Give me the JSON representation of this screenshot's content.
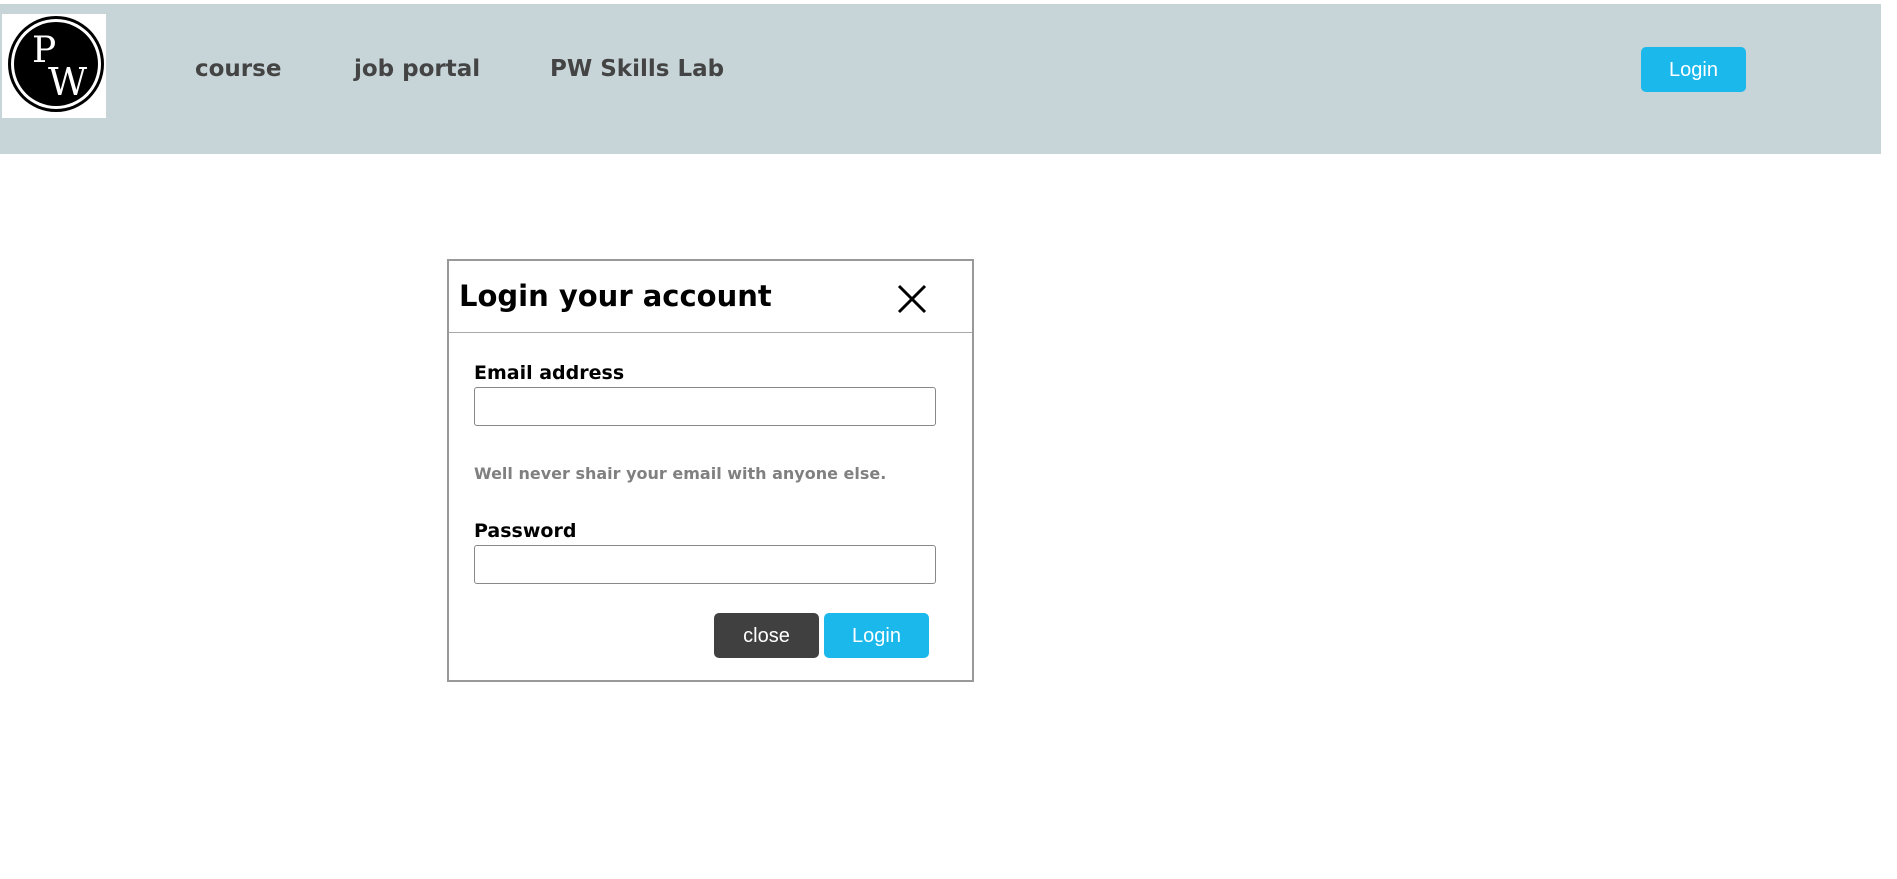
{
  "header": {
    "logo_alt": "PW",
    "logo_letter_top": "P",
    "logo_letter_bottom": "W",
    "nav": [
      {
        "label": "course"
      },
      {
        "label": "job portal"
      },
      {
        "label": "PW Skills Lab"
      }
    ],
    "login_label": "Login"
  },
  "modal": {
    "title": "Login your account",
    "close_icon": "close-x-icon",
    "email_label": "Email address",
    "email_value": "",
    "email_help": "Well never shair your email with anyone else.",
    "password_label": "Password",
    "password_value": "",
    "close_button_label": "close",
    "login_button_label": "Login"
  },
  "colors": {
    "header_bg": "#c7d5d9",
    "primary": "#1bb8ec",
    "secondary": "#404040",
    "help_text": "#808080"
  }
}
